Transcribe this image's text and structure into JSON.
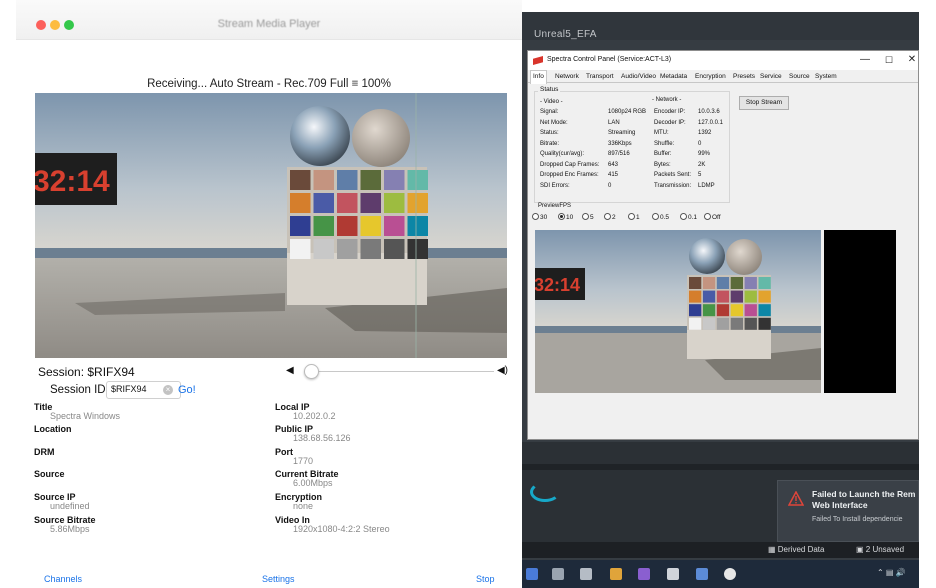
{
  "mac": {
    "title": "Stream Media Player",
    "status_line": "Receiving... Auto Stream -  Rec.709 Full  ≡ 100%",
    "session_label": "Session: $RIFX94",
    "session_id_label": "Session ID:",
    "session_id_value": "$RIFX94",
    "go_label": "Go!",
    "volume_level": 0.05,
    "info": {
      "title_k": "Title",
      "title_v": "Spectra Windows",
      "location_k": "Location",
      "drm_k": "DRM",
      "source_k": "Source",
      "source_ip_k": "Source IP",
      "source_ip_v": "undefined",
      "source_bitrate_k": "Source Bitrate",
      "source_bitrate_v": "5.86Mbps",
      "local_ip_k": "Local IP",
      "local_ip_v": "10.202.0.2",
      "public_ip_k": "Public IP",
      "public_ip_v": "138.68.56.126",
      "port_k": "Port",
      "port_v": "1770",
      "current_bitrate_k": "Current Bitrate",
      "current_bitrate_v": "6.00Mbps",
      "encryption_k": "Encryption",
      "encryption_v": "none",
      "video_in_k": "Video In",
      "video_in_v": "1920x1080-4:2:2 Stereo"
    },
    "bottom": {
      "channels": "Channels",
      "settings": "Settings",
      "stop": "Stop"
    },
    "video_clock": "32:14"
  },
  "windows": {
    "unreal_title": "Unreal5_EFA",
    "spectra_title": "Spectra Control Panel (Service:ACT-L3)",
    "tabs": [
      "Info",
      "Network",
      "Transport",
      "Audio/Video",
      "Metadata",
      "Encryption",
      "Presets",
      "Service",
      "Source",
      "System"
    ],
    "status_title": "Status",
    "video_header": "- Video -",
    "network_header": "- Network -",
    "video_rows": [
      {
        "k": "Signal:",
        "v": "1080p24 RGB"
      },
      {
        "k": "Net Mode:",
        "v": "LAN"
      },
      {
        "k": "Status:",
        "v": "Streaming"
      },
      {
        "k": "Bitrate:",
        "v": "336Kbps"
      },
      {
        "k": "Quality(cur/avg):",
        "v": "897/516"
      },
      {
        "k": "Dropped Cap Frames:",
        "v": "643"
      },
      {
        "k": "Dropped Enc Frames:",
        "v": "415"
      },
      {
        "k": "SDI Errors:",
        "v": "0"
      }
    ],
    "network_rows": [
      {
        "k": "Encoder IP:",
        "v": "10.0.3.6"
      },
      {
        "k": "Decoder IP:",
        "v": "127.0.0.1"
      },
      {
        "k": "MTU:",
        "v": "1392"
      },
      {
        "k": "Shuffle:",
        "v": "0"
      },
      {
        "k": "Buffer:",
        "v": "99%"
      },
      {
        "k": "Bytes:",
        "v": "2K"
      },
      {
        "k": "Packets Sent:",
        "v": "5"
      },
      {
        "k": "Transmission:",
        "v": "LDMP"
      }
    ],
    "stop_stream": "Stop Stream",
    "preview_fps_title": "PreviewFPS",
    "fps_options": [
      "30",
      "10",
      "5",
      "2",
      "1",
      "0.5",
      "0.1",
      "Off"
    ],
    "fps_selected": "10",
    "preview_clock": "32:14",
    "toast": {
      "title": "Failed to Launch the Rem",
      "title2": "Web Interface",
      "body": "Failed To Install dependencie"
    },
    "ue_status": {
      "derived": "Derived Data",
      "unsaved": "2 Unsaved"
    },
    "colors": {
      "accent_link": "#1a73e8",
      "toast_error": "#e0453a",
      "spectra_logo": "#d9342b"
    }
  }
}
